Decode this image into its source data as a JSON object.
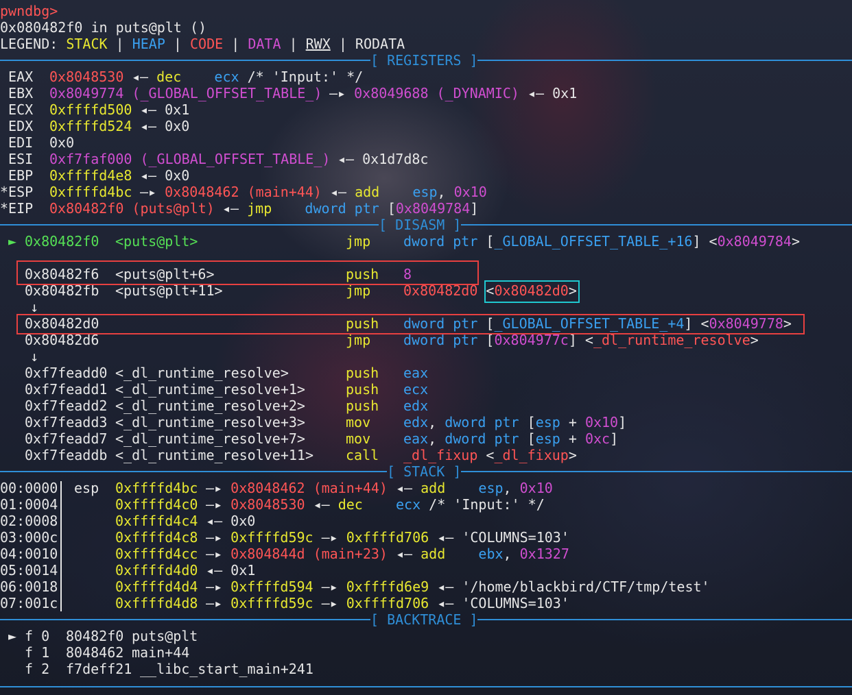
{
  "prompt": "pwndbg>",
  "location": "0x080482f0 in puts@plt ()",
  "legend": {
    "label": "LEGEND:",
    "stack": "STACK",
    "heap": "HEAP",
    "code": "CODE",
    "data": "DATA",
    "rwx": "RWX",
    "rodata": "RODATA",
    "sep": "|"
  },
  "sections": {
    "registers": "[ REGISTERS ]",
    "disasm": "[ DISASM ]",
    "stack": "[ STACK ]",
    "backtrace": "[ BACKTRACE ]"
  },
  "arrows": {
    "deref": "—▸",
    "points": "◂—",
    "down": "↓",
    "cur": "►"
  },
  "registers": [
    {
      "name": " EAX",
      "val": "0x8048530",
      "rest": [
        [
          "◂— ",
          "wht"
        ],
        [
          "dec",
          "yel"
        ],
        [
          "    ",
          "wht"
        ],
        [
          "ecx",
          "blu"
        ],
        [
          " /* 'Input:' */",
          "wht"
        ]
      ]
    },
    {
      "name": " EBX",
      "val": "0x8049774 (_GLOBAL_OFFSET_TABLE_)",
      "rest": [
        [
          "—▸ ",
          "wht"
        ],
        [
          "0x8049688 (_DYNAMIC)",
          "mag"
        ],
        [
          " ◂— 0x1",
          "wht"
        ]
      ]
    },
    {
      "name": " ECX",
      "val": "0xffffd500",
      "rest": [
        [
          "◂— 0x1",
          "wht"
        ]
      ]
    },
    {
      "name": " EDX",
      "val": "0xffffd524",
      "rest": [
        [
          "◂— 0x0",
          "wht"
        ]
      ]
    },
    {
      "name": " EDI",
      "val": "0x0",
      "rest": []
    },
    {
      "name": " ESI",
      "val": "0xf7faf000 (_GLOBAL_OFFSET_TABLE_)",
      "rest": [
        [
          "◂— 0x1d7d8c",
          "wht"
        ]
      ]
    },
    {
      "name": " EBP",
      "val": "0xffffd4e8",
      "rest": [
        [
          "◂— 0x0",
          "wht"
        ]
      ]
    },
    {
      "name": "*ESP",
      "val": "0xffffd4bc",
      "rest": [
        [
          "—▸ ",
          "wht"
        ],
        [
          "0x8048462 (main+44)",
          "red"
        ],
        [
          " ◂— ",
          "wht"
        ],
        [
          "add",
          "yel"
        ],
        [
          "    ",
          "wht"
        ],
        [
          "esp",
          "blu"
        ],
        [
          ", ",
          "wht"
        ],
        [
          "0x10",
          "mag"
        ]
      ]
    },
    {
      "name": "*EIP",
      "val": "0x80482f0 (puts@plt)",
      "rest": [
        [
          "◂— ",
          "wht"
        ],
        [
          "jmp",
          "yel"
        ],
        [
          "    ",
          "wht"
        ],
        [
          "dword ptr",
          "blu"
        ],
        [
          " [",
          "wht"
        ],
        [
          "0x8049784",
          "mag"
        ],
        [
          "]",
          "wht"
        ]
      ]
    }
  ],
  "disasm": [
    {
      "cur": true,
      "addr": "0x80482f0",
      "sym": "<puts@plt>",
      "mn": "jmp",
      "ops": [
        [
          "dword ptr",
          "blu"
        ],
        [
          " [",
          "wht"
        ],
        [
          "_GLOBAL_OFFSET_TABLE_+16",
          "blu"
        ],
        [
          "] <",
          "wht"
        ],
        [
          "0x8049784",
          "mag"
        ],
        [
          ">",
          "wht"
        ]
      ]
    },
    {
      "blank": true
    },
    {
      "addr": "0x80482f6",
      "sym": "<puts@plt+6>",
      "mn": "push",
      "ops": [
        [
          "8",
          "mag"
        ]
      ]
    },
    {
      "addr": "0x80482fb",
      "sym": "<puts@plt+11>",
      "mn": "jmp",
      "ops": [
        [
          "0x80482d0",
          "red"
        ],
        [
          " <",
          "wht"
        ],
        [
          "0x80482d0",
          "red"
        ],
        [
          ">",
          "wht"
        ]
      ]
    },
    {
      "down": true
    },
    {
      "addr": "0x80482d0",
      "sym": "",
      "mn": "push",
      "ops": [
        [
          "dword ptr",
          "blu"
        ],
        [
          " [",
          "wht"
        ],
        [
          "_GLOBAL_OFFSET_TABLE_+4",
          "blu"
        ],
        [
          "] <",
          "wht"
        ],
        [
          "0x8049778",
          "mag"
        ],
        [
          ">",
          "wht"
        ]
      ]
    },
    {
      "addr": "0x80482d6",
      "sym": "",
      "mn": "jmp",
      "ops": [
        [
          "dword ptr",
          "blu"
        ],
        [
          " [",
          "wht"
        ],
        [
          "0x804977c",
          "mag"
        ],
        [
          "] <",
          "wht"
        ],
        [
          "_dl_runtime_resolve",
          "red"
        ],
        [
          ">",
          "wht"
        ]
      ]
    },
    {
      "down": true
    },
    {
      "addr": "0xf7feadd0",
      "sym": "<_dl_runtime_resolve>",
      "mn": "push",
      "ops": [
        [
          "eax",
          "blu"
        ]
      ]
    },
    {
      "addr": "0xf7feadd1",
      "sym": "<_dl_runtime_resolve+1>",
      "mn": "push",
      "ops": [
        [
          "ecx",
          "blu"
        ]
      ]
    },
    {
      "addr": "0xf7feadd2",
      "sym": "<_dl_runtime_resolve+2>",
      "mn": "push",
      "ops": [
        [
          "edx",
          "blu"
        ]
      ]
    },
    {
      "addr": "0xf7feadd3",
      "sym": "<_dl_runtime_resolve+3>",
      "mn": "mov",
      "ops": [
        [
          "edx",
          "blu"
        ],
        [
          ", ",
          "wht"
        ],
        [
          "dword ptr",
          "blu"
        ],
        [
          " [",
          "wht"
        ],
        [
          "esp",
          "blu"
        ],
        [
          " + ",
          "wht"
        ],
        [
          "0x10",
          "mag"
        ],
        [
          "]",
          "wht"
        ]
      ]
    },
    {
      "addr": "0xf7feadd7",
      "sym": "<_dl_runtime_resolve+7>",
      "mn": "mov",
      "ops": [
        [
          "eax",
          "blu"
        ],
        [
          ", ",
          "wht"
        ],
        [
          "dword ptr",
          "blu"
        ],
        [
          " [",
          "wht"
        ],
        [
          "esp",
          "blu"
        ],
        [
          " + ",
          "wht"
        ],
        [
          "0xc",
          "mag"
        ],
        [
          "]",
          "wht"
        ]
      ]
    },
    {
      "addr": "0xf7feaddb",
      "sym": "<_dl_runtime_resolve+11>",
      "mn": "call",
      "ops": [
        [
          "_dl_fixup",
          "red"
        ],
        [
          " <",
          "wht"
        ],
        [
          "_dl_fixup",
          "red"
        ],
        [
          ">",
          "wht"
        ]
      ]
    }
  ],
  "stack": [
    {
      "idx": "00:0000",
      "reg": "esp",
      "addr": "0xffffd4bc",
      "rest": [
        [
          " —▸ ",
          "wht"
        ],
        [
          "0x8048462 (main+44)",
          "red"
        ],
        [
          " ◂— ",
          "wht"
        ],
        [
          "add",
          "yel"
        ],
        [
          "    ",
          "wht"
        ],
        [
          "esp",
          "blu"
        ],
        [
          ", ",
          "wht"
        ],
        [
          "0x10",
          "mag"
        ]
      ]
    },
    {
      "idx": "01:0004",
      "reg": "",
      "addr": "0xffffd4c0",
      "rest": [
        [
          " —▸ ",
          "wht"
        ],
        [
          "0x8048530",
          "red"
        ],
        [
          " ◂— ",
          "wht"
        ],
        [
          "dec",
          "yel"
        ],
        [
          "    ",
          "wht"
        ],
        [
          "ecx",
          "blu"
        ],
        [
          " /* 'Input:' */",
          "wht"
        ]
      ]
    },
    {
      "idx": "02:0008",
      "reg": "",
      "addr": "0xffffd4c4",
      "rest": [
        [
          " ◂— 0x0",
          "wht"
        ]
      ]
    },
    {
      "idx": "03:000c",
      "reg": "",
      "addr": "0xffffd4c8",
      "rest": [
        [
          " —▸ ",
          "wht"
        ],
        [
          "0xffffd59c",
          "yel"
        ],
        [
          " —▸ ",
          "wht"
        ],
        [
          "0xffffd706",
          "yel"
        ],
        [
          " ◂— 'COLUMNS=103'",
          "wht"
        ]
      ]
    },
    {
      "idx": "04:0010",
      "reg": "",
      "addr": "0xffffd4cc",
      "rest": [
        [
          " —▸ ",
          "wht"
        ],
        [
          "0x804844d (main+23)",
          "red"
        ],
        [
          " ◂— ",
          "wht"
        ],
        [
          "add",
          "yel"
        ],
        [
          "    ",
          "wht"
        ],
        [
          "ebx",
          "blu"
        ],
        [
          ", ",
          "wht"
        ],
        [
          "0x1327",
          "mag"
        ]
      ]
    },
    {
      "idx": "05:0014",
      "reg": "",
      "addr": "0xffffd4d0",
      "rest": [
        [
          " ◂— 0x1",
          "wht"
        ]
      ]
    },
    {
      "idx": "06:0018",
      "reg": "",
      "addr": "0xffffd4d4",
      "rest": [
        [
          " —▸ ",
          "wht"
        ],
        [
          "0xffffd594",
          "yel"
        ],
        [
          " —▸ ",
          "wht"
        ],
        [
          "0xffffd6e9",
          "yel"
        ],
        [
          " ◂— '/home/blackbird/CTF/tmp/test'",
          "wht"
        ]
      ]
    },
    {
      "idx": "07:001c",
      "reg": "",
      "addr": "0xffffd4d8",
      "rest": [
        [
          " —▸ ",
          "wht"
        ],
        [
          "0xffffd59c",
          "yel"
        ],
        [
          " —▸ ",
          "wht"
        ],
        [
          "0xffffd706",
          "yel"
        ],
        [
          " ◂— 'COLUMNS=103'",
          "wht"
        ]
      ]
    }
  ],
  "backtrace": [
    {
      "cur": true,
      "frame": "f 0",
      "addr": "80482f0",
      "sym": "puts@plt"
    },
    {
      "cur": false,
      "frame": "f 1",
      "addr": "8048462",
      "sym": "main+44"
    },
    {
      "cur": false,
      "frame": "f 2",
      "addr": "f7deff21",
      "sym": "__libc_start_main+241"
    }
  ],
  "colors": {
    "rule": "#2f8fd8",
    "highlight_box": "#e84040",
    "cyan_box": "#20c8d0"
  }
}
